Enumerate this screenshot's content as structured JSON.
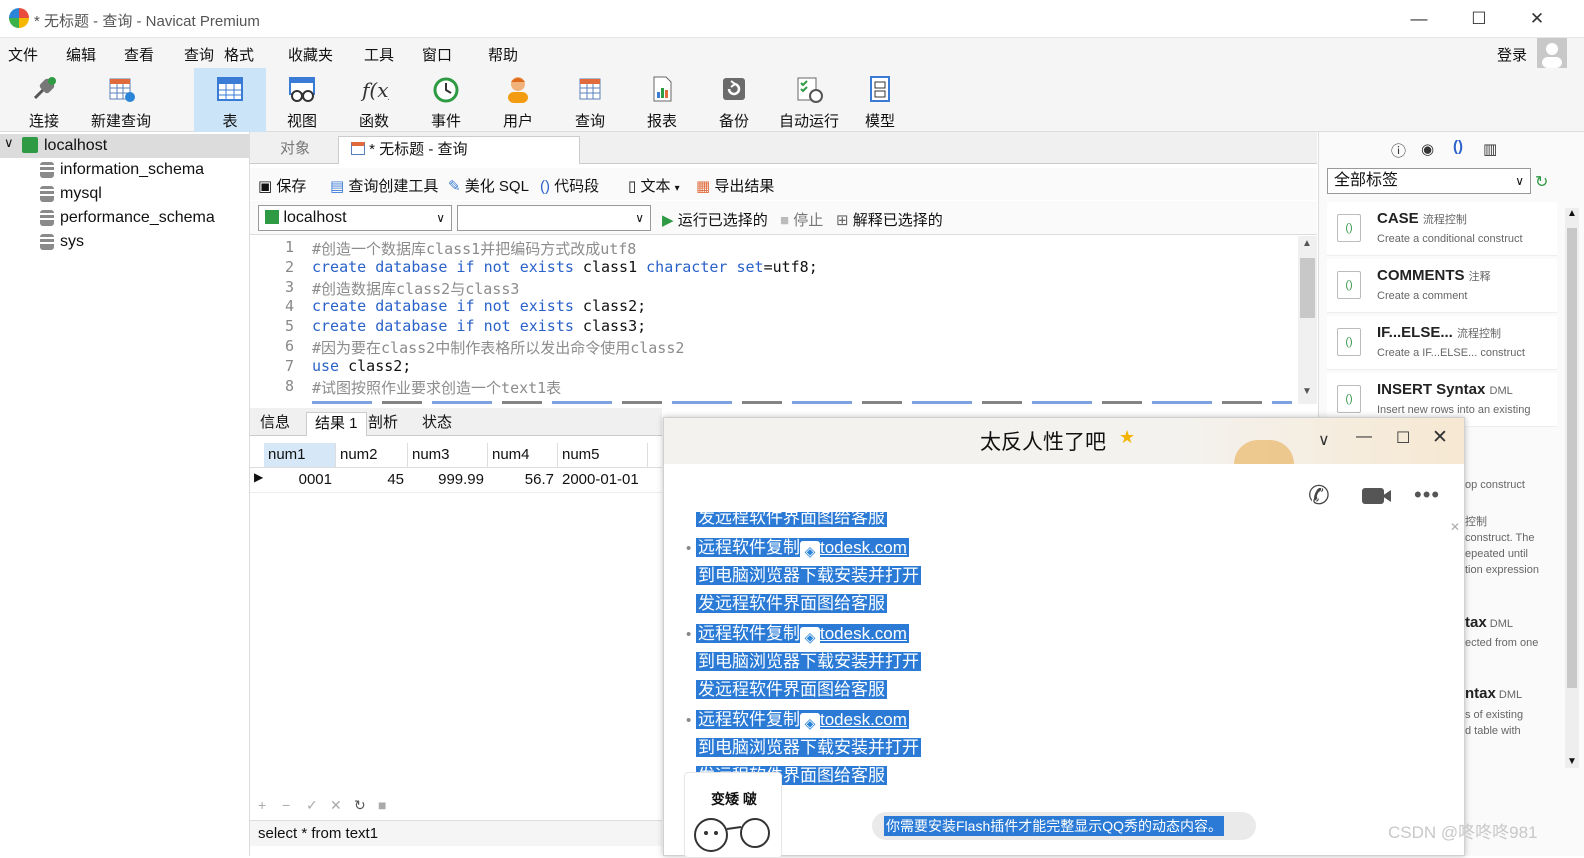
{
  "window": {
    "title": "* 无标题 - 查询 - Navicat Premium"
  },
  "menu": [
    "文件",
    "编辑",
    "查看",
    "查询",
    "格式",
    "收藏夹",
    "工具",
    "窗口",
    "帮助"
  ],
  "login": "登录",
  "toolbar": [
    "连接",
    "新建查询",
    "表",
    "视图",
    "函数",
    "事件",
    "用户",
    "查询",
    "报表",
    "备份",
    "自动运行",
    "模型"
  ],
  "tree": {
    "connection": "localhost",
    "databases": [
      "information_schema",
      "mysql",
      "performance_schema",
      "sys"
    ]
  },
  "tabs": {
    "objects": "对象",
    "query": "* 无标题 - 查询"
  },
  "editor_toolbar": {
    "save": "保存",
    "builder": "查询创建工具",
    "beautify": "美化 SQL",
    "snippet": "代码段",
    "text": "文本",
    "export": "导出结果"
  },
  "run_bar": {
    "connection": "localhost",
    "database": "",
    "run": "运行已选择的",
    "stop": "停止",
    "explain": "解释已选择的"
  },
  "code_lines": [
    {
      "n": "1",
      "parts": [
        {
          "t": "#创造一个数据库class1并把编码方式改成utf8",
          "c": "cm"
        }
      ]
    },
    {
      "n": "2",
      "parts": [
        {
          "t": "create database if not exists",
          "c": "kw"
        },
        {
          "t": " class1 ",
          "c": ""
        },
        {
          "t": "character set",
          "c": "kw"
        },
        {
          "t": "=utf8;",
          "c": ""
        }
      ]
    },
    {
      "n": "3",
      "parts": [
        {
          "t": "#创造数据库class2与class3",
          "c": "cm"
        }
      ]
    },
    {
      "n": "4",
      "parts": [
        {
          "t": "create database if not exists",
          "c": "kw"
        },
        {
          "t": " class2;",
          "c": ""
        }
      ]
    },
    {
      "n": "5",
      "parts": [
        {
          "t": "create database if not exists",
          "c": "kw"
        },
        {
          "t": " class3;",
          "c": ""
        }
      ]
    },
    {
      "n": "6",
      "parts": [
        {
          "t": "#因为要在class2中制作表格所以发出命令使用class2",
          "c": "cm"
        }
      ]
    },
    {
      "n": "7",
      "parts": [
        {
          "t": "use",
          "c": "kw"
        },
        {
          "t": " class2;",
          "c": ""
        }
      ]
    },
    {
      "n": "8",
      "parts": [
        {
          "t": "#试图按照作业要求创造一个text1表",
          "c": "cm"
        }
      ]
    }
  ],
  "result_tabs": [
    "信息",
    "结果 1",
    "剖析",
    "状态"
  ],
  "grid": {
    "columns": [
      "num1",
      "num2",
      "num3",
      "num4",
      "num5"
    ],
    "row": [
      "0001",
      "45",
      "999.99",
      "56.7",
      "2000-01-01"
    ]
  },
  "status": "select * from text1",
  "right_panel": {
    "filter": "全部标签",
    "snippets": [
      {
        "title": "CASE",
        "tag": "流程控制",
        "desc": "Create a conditional construct"
      },
      {
        "title": "COMMENTS",
        "tag": "注释",
        "desc": "Create a comment"
      },
      {
        "title": "IF...ELSE...",
        "tag": "流程控制",
        "desc": "Create a IF...ELSE... construct"
      },
      {
        "title": "INSERT Syntax",
        "tag": "DML",
        "desc": "Insert new rows into an existing"
      }
    ],
    "partial": [
      "op construct",
      "控制",
      "construct. The",
      "epeated until",
      "tion expression",
      "tax",
      "DML",
      "ected from one",
      "ntax",
      "DML",
      "s of existing",
      "d table with"
    ]
  },
  "qq": {
    "title": "太反人性了吧",
    "lines": [
      "发远程软件界面图给客服",
      "远程软件复制",
      "todesk.com",
      "到电脑浏览器下载安装并打开",
      "发远程软件界面图给客服"
    ],
    "sticker": "变矮 啵",
    "flash": "你需要安装Flash插件才能完整显示QQ秀的动态内容。"
  },
  "watermark": "CSDN @咚咚咚981"
}
